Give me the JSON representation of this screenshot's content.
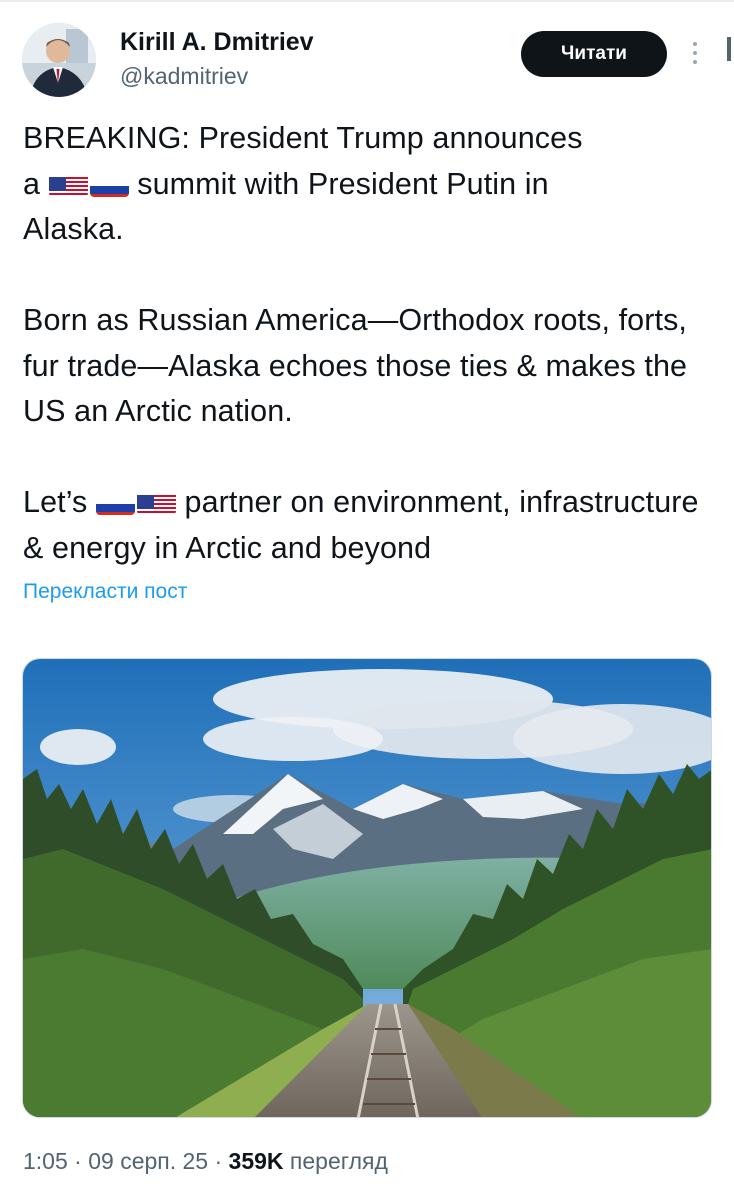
{
  "author": {
    "name": "Kirill A. Dmitriev",
    "handle": "@kadmitriev"
  },
  "follow_label": "Читати",
  "tweet": {
    "line1": "BREAKING: President Trump announces",
    "line2_pre": "a ",
    "line2_post": " summit with President Putin in",
    "line3": "Alaska.",
    "para2": "Born as Russian America—Orthodox roots, forts, fur trade—Alaska echoes those ties & makes the US an Arctic nation.",
    "para3_pre": "Let’s ",
    "para3_post": " partner on environment, infrastructure & energy in Arctic and beyond"
  },
  "translate_label": "Перекласти пост",
  "meta": {
    "time": "1:05",
    "sep1": " · ",
    "date": "09 серп. 25",
    "sep2": " · ",
    "views": "359K",
    "views_label": " перегляд"
  },
  "icons": {
    "more": "more-vertical-icon",
    "flag_us": "us-flag-icon",
    "flag_ru": "russia-flag-icon"
  },
  "colors": {
    "text": "#0f1419",
    "secondary": "#536471",
    "link": "#1d9bf0",
    "button_bg": "#0f1419"
  }
}
